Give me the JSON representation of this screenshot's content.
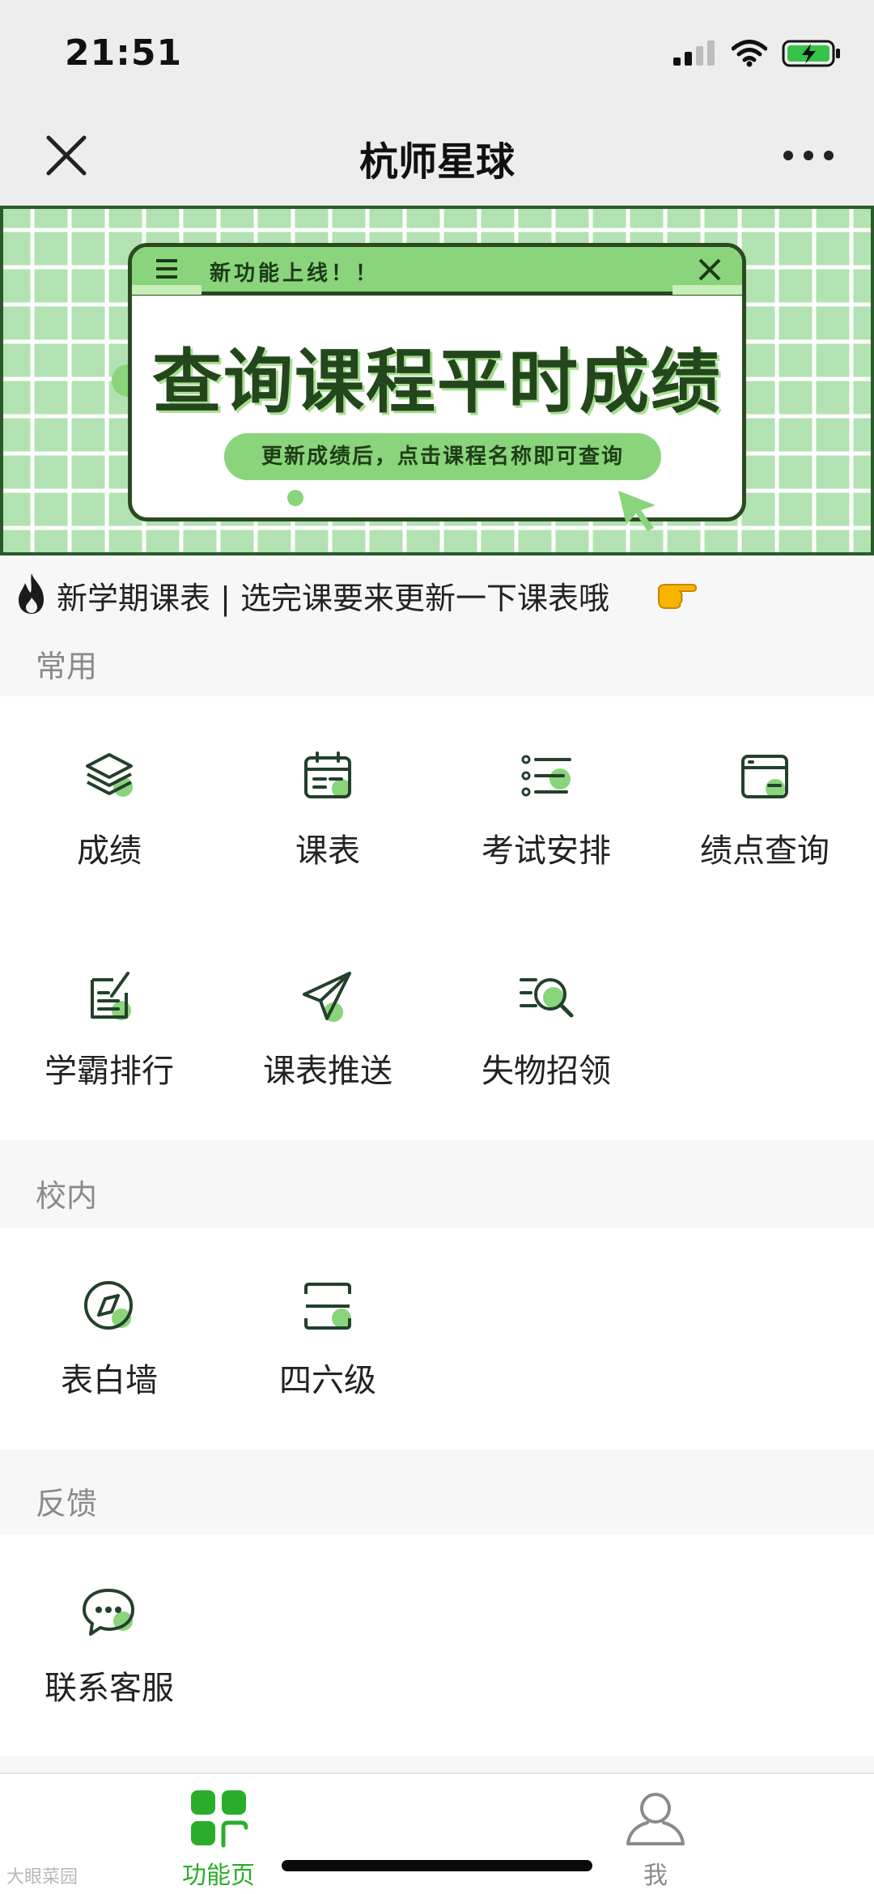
{
  "status_bar": {
    "time": "21:51"
  },
  "nav": {
    "title": "杭师星球"
  },
  "banner": {
    "header_text": "新功能上线！！",
    "title": "查询课程平时成绩",
    "subtitle": "更新成绩后，点击课程名称即可查询"
  },
  "notice": {
    "text": "新学期课表 | 选完课要来更新一下课表哦"
  },
  "sections": {
    "common": {
      "label": "常用",
      "items": [
        {
          "label": "成绩",
          "icon": "layers-icon"
        },
        {
          "label": "课表",
          "icon": "calendar-icon"
        },
        {
          "label": "考试安排",
          "icon": "list-icon"
        },
        {
          "label": "绩点查询",
          "icon": "card-icon"
        },
        {
          "label": "学霸排行",
          "icon": "notepad-icon"
        },
        {
          "label": "课表推送",
          "icon": "paper-plane-icon"
        },
        {
          "label": "失物招领",
          "icon": "search-list-icon"
        }
      ]
    },
    "campus": {
      "label": "校内",
      "items": [
        {
          "label": "表白墙",
          "icon": "compass-icon"
        },
        {
          "label": "四六级",
          "icon": "scan-icon"
        }
      ]
    },
    "feedback": {
      "label": "反馈",
      "items": [
        {
          "label": "联系客服",
          "icon": "chat-bubble-icon"
        }
      ]
    }
  },
  "tab_bar": {
    "tabs": [
      {
        "label": "功能页",
        "active": true
      },
      {
        "label": "我",
        "active": false
      }
    ]
  },
  "watermark": {
    "text": "大眼菜园"
  },
  "colors": {
    "accent": "#2aae2a",
    "icon_dark": "#23402c",
    "icon_highlight": "#8ad47b",
    "banner_bg": "#5db46a"
  }
}
